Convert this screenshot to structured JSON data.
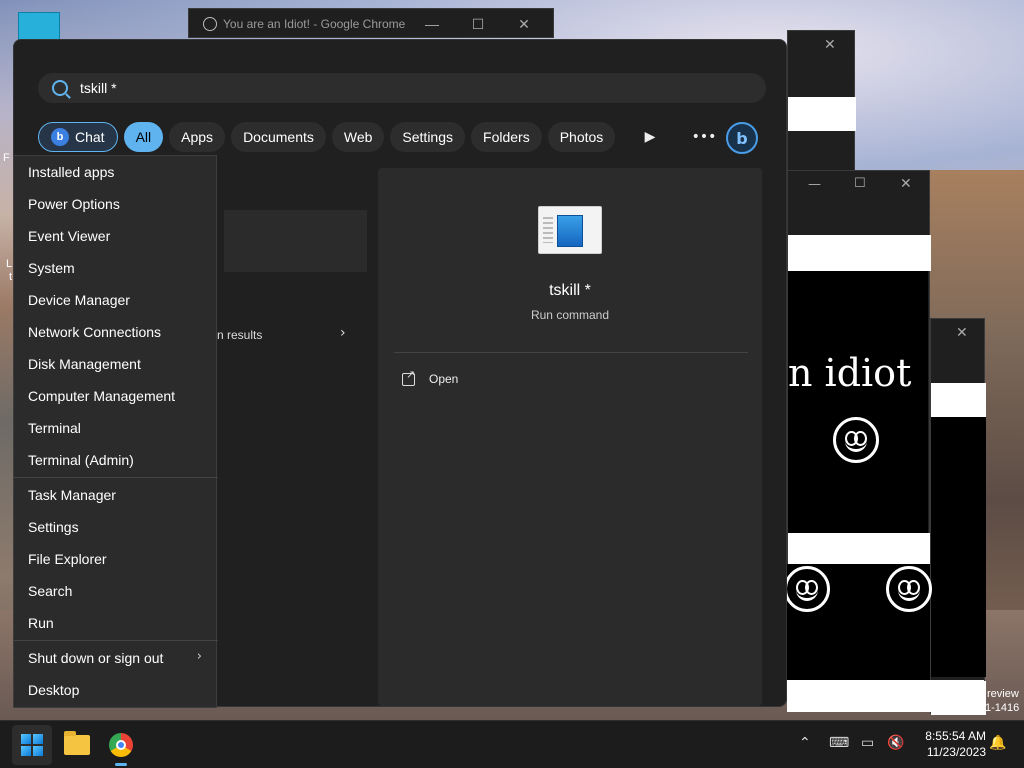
{
  "desktop": {
    "edge_text_1": "L",
    "edge_text_2": "t",
    "edge_text_3": "F",
    "watermark_line1": "review",
    "watermark_line2": "1-1416"
  },
  "background_windows": {
    "chrome_title": "You are an Idiot! - Google Chrome",
    "idiot_text": "n idiot"
  },
  "search": {
    "query": "tskill *"
  },
  "filters": {
    "chat": "Chat",
    "all": "All",
    "apps": "Apps",
    "documents": "Documents",
    "web": "Web",
    "settings": "Settings",
    "folders": "Folders",
    "photos": "Photos",
    "play_icon": "play-icon",
    "more_icon": "more-icon",
    "bing_icon": "bing-icon"
  },
  "results": {
    "fragment": "n results"
  },
  "preview": {
    "name": "tskill *",
    "type": "Run command",
    "open_label": "Open"
  },
  "context_menu": {
    "items": [
      "Installed apps",
      "Power Options",
      "Event Viewer",
      "System",
      "Device Manager",
      "Network Connections",
      "Disk Management",
      "Computer Management",
      "Terminal",
      "Terminal (Admin)",
      "Task Manager",
      "Settings",
      "File Explorer",
      "Search",
      "Run",
      "Shut down or sign out",
      "Desktop"
    ]
  },
  "taskbar": {
    "time": "8:55:54 AM",
    "date": "11/23/2023"
  },
  "colors": {
    "accent": "#5fb4f0",
    "menu_bg": "#202020",
    "panel_bg": "#2b2b2b",
    "taskbar_bg": "#1c1c1c"
  }
}
